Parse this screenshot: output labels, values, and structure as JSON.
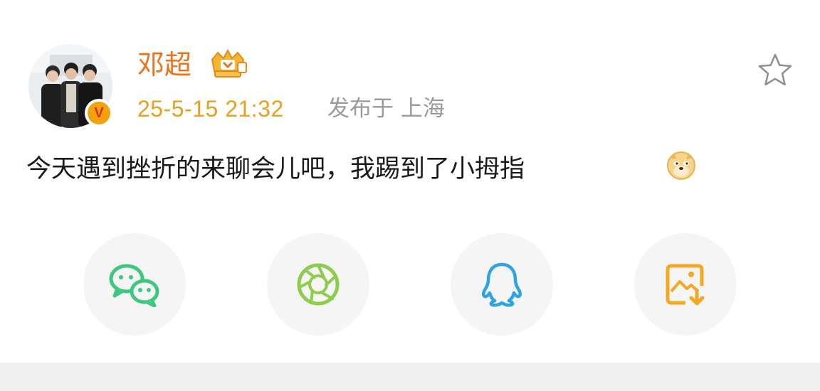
{
  "post": {
    "author": "邓超",
    "timestamp": "25-5-15 21:32",
    "location": "发布于 上海",
    "text": "今天遇到挫折的来聊会儿吧，我踢到了小拇指",
    "emoji": "doge-emoji",
    "verified_badge": "V",
    "icons": {
      "crown": "crown-badge-icon",
      "favorite": "star-icon"
    }
  },
  "share": {
    "items": [
      {
        "name": "wechat",
        "icon": "wechat-icon",
        "color": "#3ec77e"
      },
      {
        "name": "moments",
        "icon": "moments-icon",
        "color": "#8fcc4e"
      },
      {
        "name": "qq",
        "icon": "qq-icon",
        "color": "#2fa3e6"
      },
      {
        "name": "save-image",
        "icon": "save-image-icon",
        "color": "#f5a623"
      }
    ]
  },
  "colors": {
    "author": "#e8741c",
    "timestamp": "#e8a020",
    "location": "#9a9a9a"
  }
}
